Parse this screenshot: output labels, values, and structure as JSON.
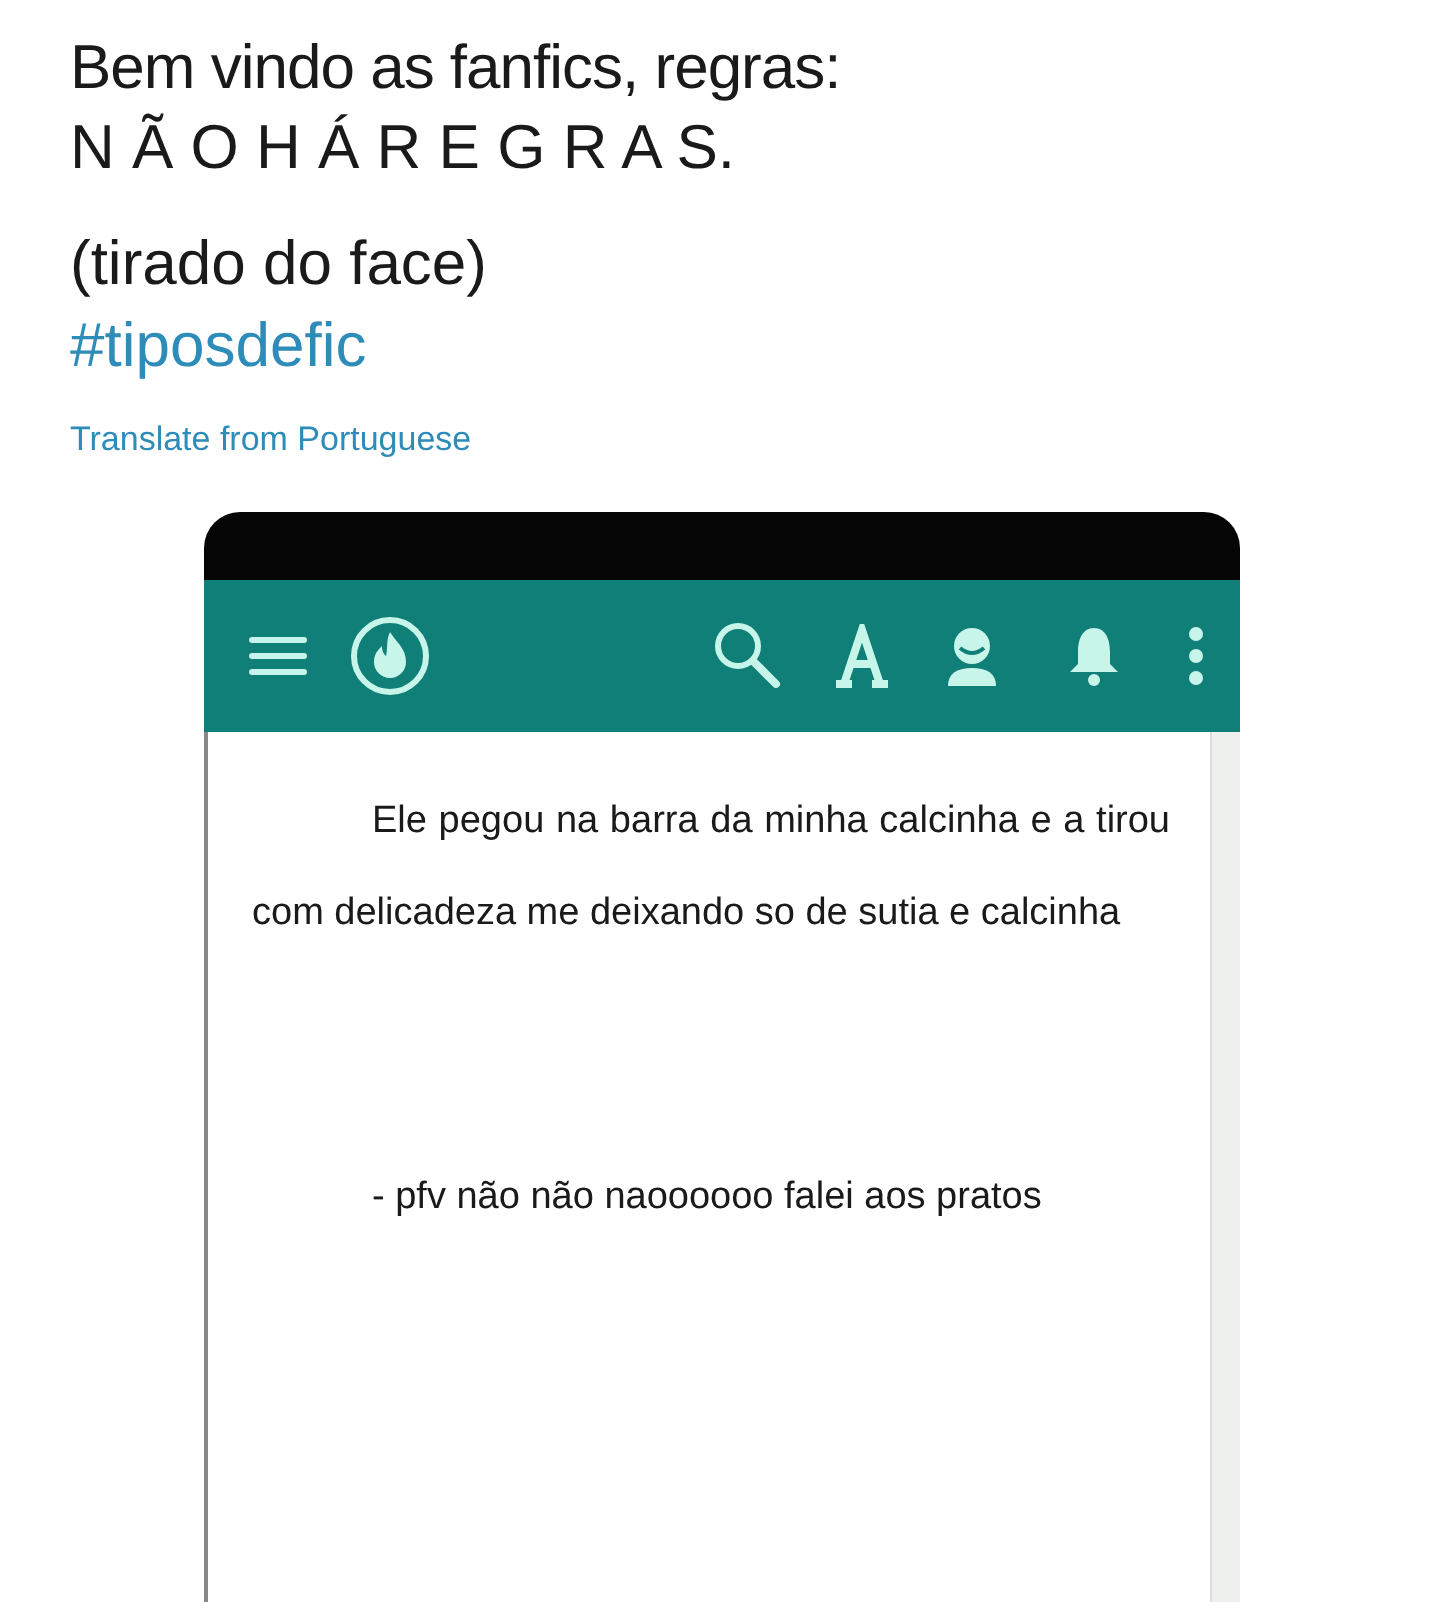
{
  "tweet": {
    "lines": [
      "Bem vindo as fanfics, regras:",
      "N Ã O H Á R E G R A S."
    ],
    "note": "(tirado do face)",
    "hashtag": "#tiposdefic",
    "translate_link": "Translate from Portuguese"
  },
  "embedded_screenshot": {
    "story_paragraphs": [
      "Ele pegou na barra da minha calcinha e a tirou com delicadeza me deixando so de sutia e calcinha",
      "- pfv não não naoooooo falei aos pratos"
    ]
  }
}
